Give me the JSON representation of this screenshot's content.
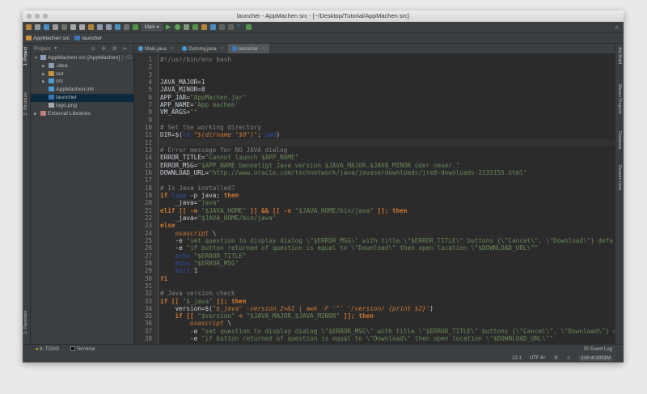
{
  "window": {
    "title": "launcher - AppMachen src - [~/Desktop/Tutorial/AppMachen src]"
  },
  "toolbar": {
    "run_config": "Main ▾"
  },
  "breadcrumb": [
    "AppMachen src",
    "launcher"
  ],
  "project_panel": {
    "header": "Project",
    "tree": [
      {
        "label": "AppMachen src [AppMachen]",
        "hint": " (~/D",
        "depth": 0,
        "arrow": "▼",
        "kind": "folder"
      },
      {
        "label": ".idea",
        "depth": 1,
        "arrow": "▶",
        "kind": "folder"
      },
      {
        "label": "out",
        "depth": 1,
        "arrow": "▶",
        "kind": "folder-orange"
      },
      {
        "label": "src",
        "depth": 1,
        "arrow": "▶",
        "kind": "folder-blue"
      },
      {
        "label": "AppMachen.iml",
        "depth": 1,
        "arrow": "",
        "kind": "iml"
      },
      {
        "label": "launcher",
        "depth": 1,
        "arrow": "",
        "kind": "script",
        "selected": true
      },
      {
        "label": "logo.png",
        "depth": 1,
        "arrow": "",
        "kind": "file"
      },
      {
        "label": "External Libraries",
        "depth": 0,
        "arrow": "▶",
        "kind": "lib"
      }
    ]
  },
  "left_stripe": {
    "project": "1: Project",
    "structure": "Z: Structure",
    "favorites": "2: Favorites"
  },
  "right_stripe": [
    "Ant Build",
    "Maven Projects",
    "Database",
    "Remote Host"
  ],
  "tabs": [
    {
      "label": "Main.java",
      "icon": "#4a9bd6"
    },
    {
      "label": "Dummy.java",
      "icon": "#4a9bd6"
    },
    {
      "label": "launcher",
      "icon": "#3c75b5",
      "active": true
    }
  ],
  "code": {
    "lines": [
      [
        {
          "c": "c",
          "s": "#!/usr/bin/env bash"
        }
      ],
      [],
      [],
      [
        {
          "c": "d",
          "s": "JAVA_MAJOR=1"
        }
      ],
      [
        {
          "c": "d",
          "s": "JAVA_MINOR=8"
        }
      ],
      [
        {
          "c": "d",
          "s": "APP_JAR="
        },
        {
          "c": "s",
          "s": "\"AppMachen.jar\""
        }
      ],
      [
        {
          "c": "d",
          "s": "APP_NAME="
        },
        {
          "c": "s",
          "s": "'App machen'"
        }
      ],
      [
        {
          "c": "d",
          "s": "VM_ARGS="
        },
        {
          "c": "s",
          "s": "\"\""
        }
      ],
      [],
      [
        {
          "c": "c",
          "s": "# Set the working directory"
        }
      ],
      [
        {
          "c": "d",
          "s": "DIR=$("
        },
        {
          "c": "b",
          "s": "cd"
        },
        {
          "c": "i",
          "s": " \"$(dirname \"$0\")\""
        },
        {
          "c": "d",
          "s": "; "
        },
        {
          "c": "b",
          "s": "pwd"
        },
        {
          "c": "d",
          "s": ")"
        }
      ],
      [],
      [
        {
          "c": "c",
          "s": "# Error message for NO JAVA dialog"
        }
      ],
      [
        {
          "c": "d",
          "s": "ERROR_TITLE="
        },
        {
          "c": "s",
          "s": "\"Cannot launch $APP_NAME\""
        }
      ],
      [
        {
          "c": "d",
          "s": "ERROR_MSG="
        },
        {
          "c": "s",
          "s": "\"$APP_NAME benoetigt Java version $JAVA_MAJOR.$JAVA_MINOR oder neuer.\""
        }
      ],
      [
        {
          "c": "d",
          "s": "DOWNLOAD_URL="
        },
        {
          "c": "s",
          "s": "\"http://www.oracle.com/technetwork/java/javase/downloads/jre8-downloads-2133155.html\""
        }
      ],
      [],
      [
        {
          "c": "c",
          "s": "# Is Java installed?"
        }
      ],
      [
        {
          "c": "k",
          "s": "if "
        },
        {
          "c": "b",
          "s": "type"
        },
        {
          "c": "d",
          "s": " -p java; "
        },
        {
          "c": "k",
          "s": "then"
        }
      ],
      [
        {
          "c": "d",
          "s": "    _java="
        },
        {
          "c": "s",
          "s": "\"java\""
        }
      ],
      [
        {
          "c": "k",
          "s": "elif [[ -n "
        },
        {
          "c": "s",
          "s": "\"$JAVA_HOME\""
        },
        {
          "c": "k",
          "s": " ]] && [[ -x "
        },
        {
          "c": "s",
          "s": "\"$JAVA_HOME/bin/java\""
        },
        {
          "c": "k",
          "s": " ]]; then"
        }
      ],
      [
        {
          "c": "d",
          "s": "    _java="
        },
        {
          "c": "s",
          "s": "\"$JAVA_HOME/bin/java\""
        }
      ],
      [
        {
          "c": "k",
          "s": "else"
        }
      ],
      [
        {
          "c": "d",
          "s": "    "
        },
        {
          "c": "i",
          "s": "osascript"
        },
        {
          "c": "d",
          "s": " \\"
        }
      ],
      [
        {
          "c": "d",
          "s": "    -e "
        },
        {
          "c": "s",
          "s": "\"set question to display dialog \\\"$ERROR_MSG\\\" with title \\\"$ERROR_TITLE\\\" buttons {\\\"Cancel\\\", \\\"Download\\\"} defa"
        }
      ],
      [
        {
          "c": "d",
          "s": "    -e "
        },
        {
          "c": "s",
          "s": "\"if button returned of question is equal to \\\"Download\\\" then open location \\\"$DOWNLOAD_URL\\\"\""
        }
      ],
      [
        {
          "c": "d",
          "s": "    "
        },
        {
          "c": "b",
          "s": "echo"
        },
        {
          "c": "d",
          "s": " "
        },
        {
          "c": "s",
          "s": "\"$ERROR_TITLE\""
        }
      ],
      [
        {
          "c": "d",
          "s": "    "
        },
        {
          "c": "b",
          "s": "echo"
        },
        {
          "c": "d",
          "s": " "
        },
        {
          "c": "s",
          "s": "\"$ERROR_MSG\""
        }
      ],
      [
        {
          "c": "d",
          "s": "    "
        },
        {
          "c": "b",
          "s": "exit"
        },
        {
          "c": "d",
          "s": " 1"
        }
      ],
      [
        {
          "c": "k",
          "s": "fi"
        }
      ],
      [],
      [
        {
          "c": "c",
          "s": "# Java version check"
        }
      ],
      [
        {
          "c": "k",
          "s": "if [[ "
        },
        {
          "c": "s",
          "s": "\"$_java\""
        },
        {
          "c": "k",
          "s": " ]]; then"
        }
      ],
      [
        {
          "c": "d",
          "s": "    version=$("
        },
        {
          "c": "i",
          "s": "\"$_java\" -version 2>&1 | awk -F '\"' '/version/ {print $2}'"
        },
        {
          "c": "d",
          "s": ")"
        }
      ],
      [
        {
          "c": "d",
          "s": "    "
        },
        {
          "c": "k",
          "s": "if [[ "
        },
        {
          "c": "s",
          "s": "\"$version\""
        },
        {
          "c": "k",
          "s": " < "
        },
        {
          "c": "s",
          "s": "\"$JAVA_MAJOR.$JAVA_MINOR\""
        },
        {
          "c": "k",
          "s": " ]]; then"
        }
      ],
      [
        {
          "c": "d",
          "s": "        "
        },
        {
          "c": "i",
          "s": "osascript"
        },
        {
          "c": "d",
          "s": " \\"
        }
      ],
      [
        {
          "c": "d",
          "s": "        -e "
        },
        {
          "c": "s",
          "s": "\"set question to display dialog \\\"$ERROR_MSG\\\" with title \\\"$ERROR_TITLE\\\" buttons {\\\"Cancel\\\", \\\"Download\\\"} d"
        }
      ],
      [
        {
          "c": "d",
          "s": "        -e "
        },
        {
          "c": "s",
          "s": "\"if button returned of question is equal to \\\"Download\\\" then open location \\\"$DOWNLOAD_URL\\\"\""
        }
      ]
    ],
    "caret_line": 12
  },
  "bottom_tools": {
    "todo": "6: TODO",
    "terminal": "Terminal"
  },
  "status": {
    "event_log": "Event Log",
    "position": "12:1",
    "encoding": "UTF-8÷",
    "memory": "216 of 2031M"
  }
}
